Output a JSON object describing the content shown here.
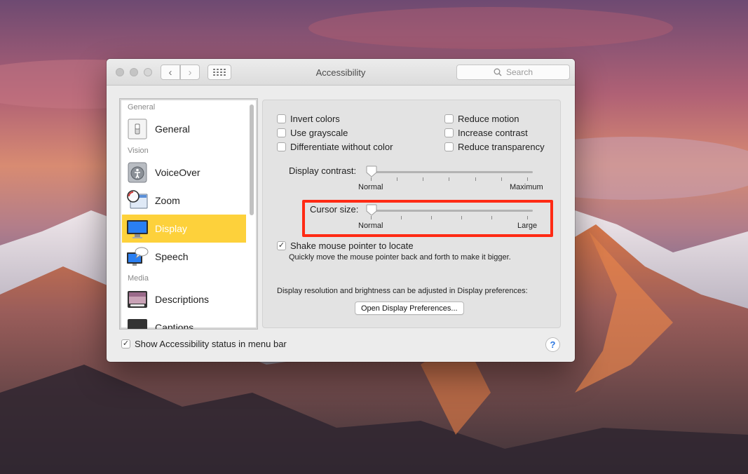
{
  "window": {
    "title": "Accessibility",
    "search_placeholder": "Search"
  },
  "sidebar": {
    "groups": [
      "General",
      "Vision",
      "Media"
    ],
    "items": [
      {
        "label": "General",
        "icon": "switch-icon"
      },
      {
        "label": "VoiceOver",
        "icon": "voiceover-icon"
      },
      {
        "label": "Zoom",
        "icon": "magnifier-icon"
      },
      {
        "label": "Display",
        "icon": "monitor-icon",
        "selected": true
      },
      {
        "label": "Speech",
        "icon": "speech-icon"
      },
      {
        "label": "Descriptions",
        "icon": "descriptions-icon"
      },
      {
        "label": "Captions",
        "icon": "captions-icon"
      }
    ]
  },
  "display": {
    "checkboxes_left": [
      {
        "label": "Invert colors",
        "checked": false
      },
      {
        "label": "Use grayscale",
        "checked": false
      },
      {
        "label": "Differentiate without color",
        "checked": false
      }
    ],
    "checkboxes_right": [
      {
        "label": "Reduce motion",
        "checked": false
      },
      {
        "label": "Increase contrast",
        "checked": false
      },
      {
        "label": "Reduce transparency",
        "checked": false
      }
    ],
    "contrast": {
      "label": "Display contrast:",
      "min_label": "Normal",
      "max_label": "Maximum",
      "value": 0
    },
    "cursor": {
      "label": "Cursor size:",
      "min_label": "Normal",
      "max_label": "Large",
      "value": 0
    },
    "shake": {
      "label": "Shake mouse pointer to locate",
      "checked": true,
      "check_mark": "✓",
      "description": "Quickly move the mouse pointer back and forth to make it bigger."
    },
    "resolution_note": "Display resolution and brightness can be adjusted in Display preferences:",
    "open_button": "Open Display Preferences..."
  },
  "footer": {
    "status_label": "Show Accessibility status in menu bar",
    "status_checked": true,
    "check_mark": "✓",
    "help": "?"
  },
  "colors": {
    "selection": "#fdd13b",
    "highlight_box": "#ff2a14"
  }
}
